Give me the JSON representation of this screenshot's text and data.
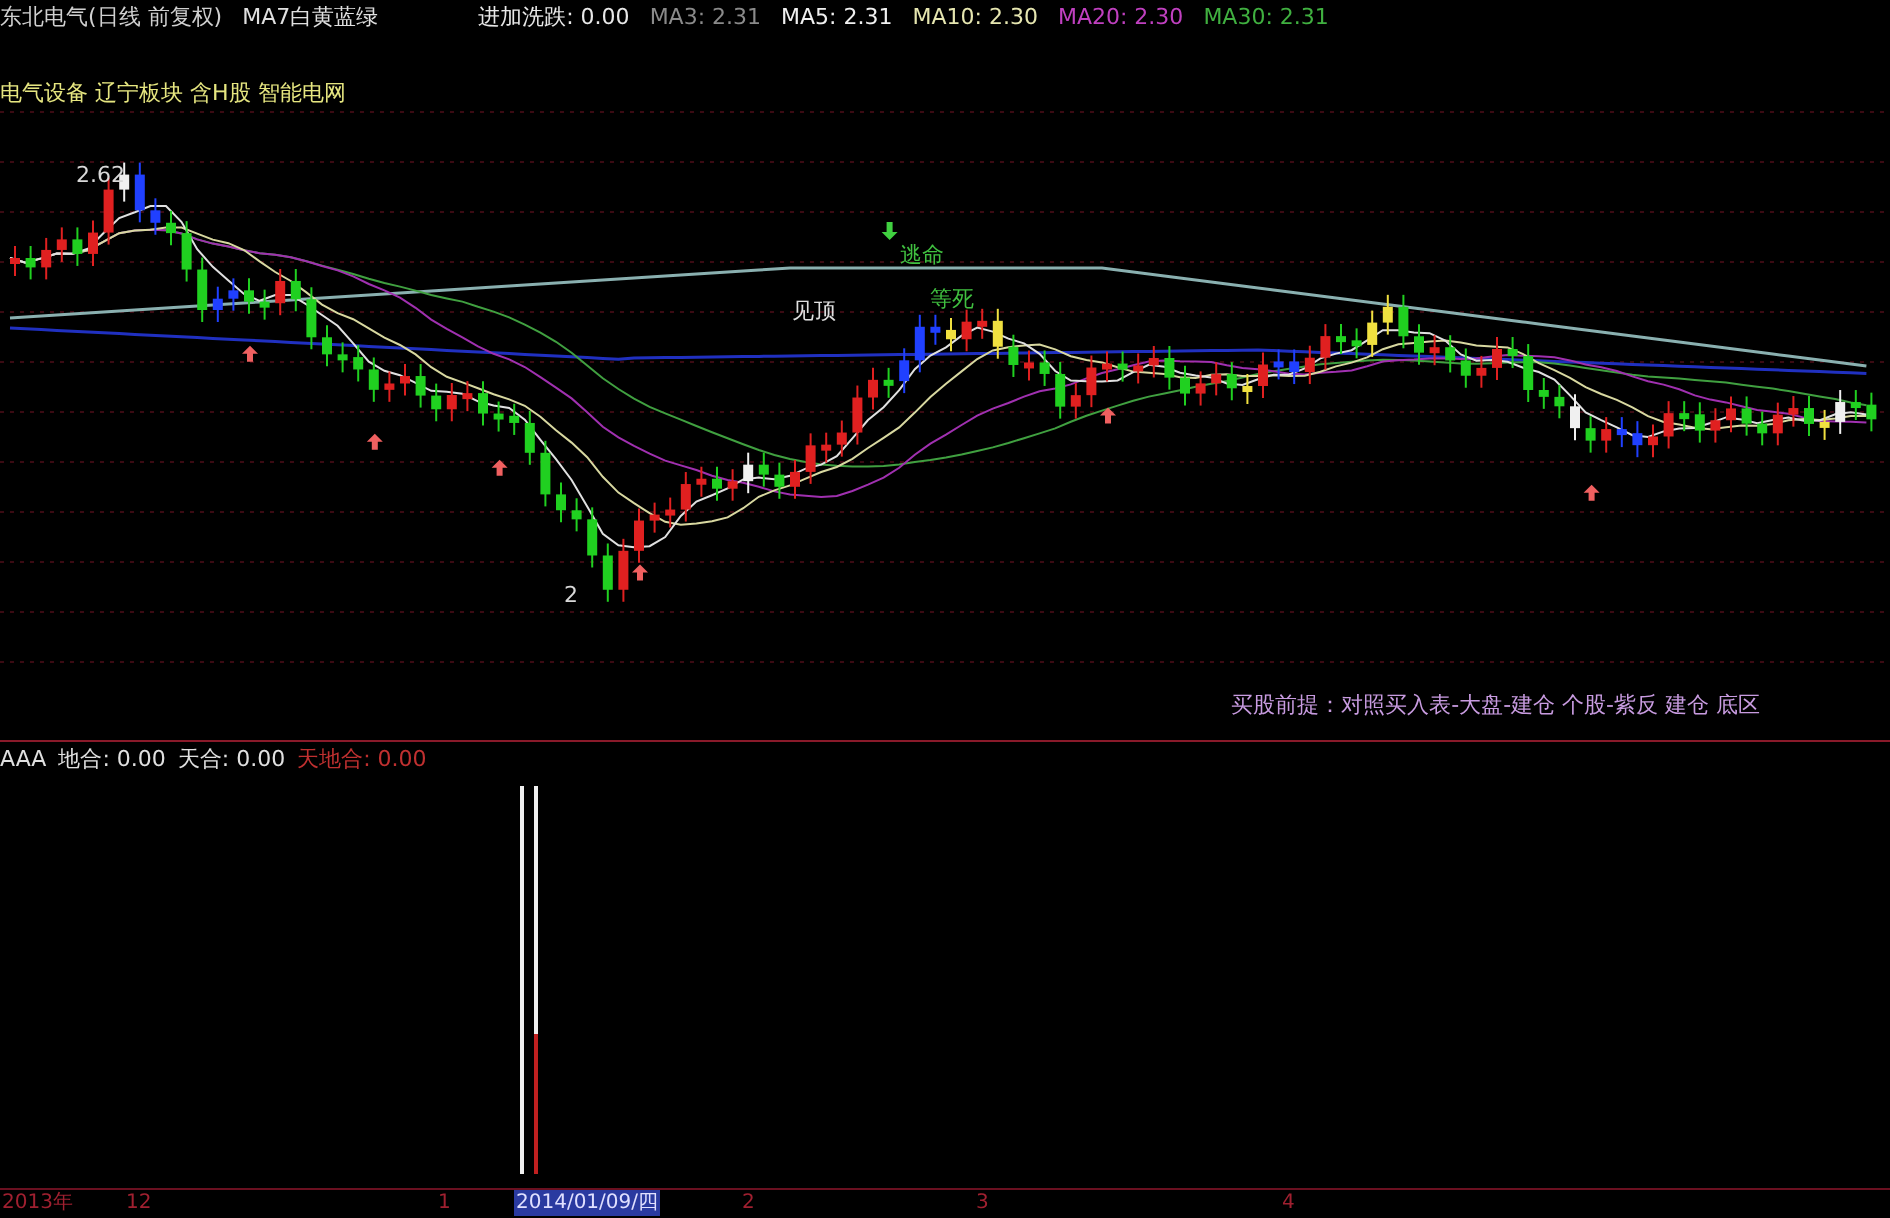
{
  "header": {
    "title": "东北电气(日线 前复权)",
    "legend": "MA7白黄蓝绿",
    "indicators": [
      {
        "label": "进加洗跌: 0.00",
        "color": "#e8e8e8"
      },
      {
        "label": "MA3: 2.31",
        "color": "#8a8a8a"
      },
      {
        "label": "MA5: 2.31",
        "color": "#f0f0f0"
      },
      {
        "label": "MA10: 2.30",
        "color": "#e6e6b0"
      },
      {
        "label": "MA20: 2.30",
        "color": "#c040c0"
      },
      {
        "label": "MA30: 2.31",
        "color": "#40b040"
      }
    ]
  },
  "sector_tags": "电气设备 辽宁板块 含H股 智能电网",
  "chart_annotations": [
    {
      "text": "2.62",
      "color": "#d8d8d8"
    },
    {
      "text": "2",
      "color": "#d8d8d8"
    },
    {
      "text": "见顶",
      "color": "#e0e0e0"
    },
    {
      "text": "逃命",
      "color": "#40c040"
    },
    {
      "text": "等死",
      "color": "#40c040"
    }
  ],
  "note": "买股前提：对照买入表-大盘-建仓  个股-紫反 建仓 底区",
  "sub_panel": {
    "indicators": [
      {
        "label": "AAA",
        "color": "#e0e0e0"
      },
      {
        "label": "地合: 0.00",
        "color": "#e0e0e0"
      },
      {
        "label": "天合: 0.00",
        "color": "#e0e0e0"
      },
      {
        "label": "天地合: 0.00",
        "color": "#c03030"
      }
    ]
  },
  "x_axis": [
    {
      "label": "2013年",
      "selected": false
    },
    {
      "label": "12",
      "selected": false
    },
    {
      "label": "1",
      "selected": false
    },
    {
      "label": "2014/01/09/四",
      "selected": true
    },
    {
      "label": "2",
      "selected": false
    },
    {
      "label": "3",
      "selected": false
    },
    {
      "label": "4",
      "selected": false
    }
  ]
}
